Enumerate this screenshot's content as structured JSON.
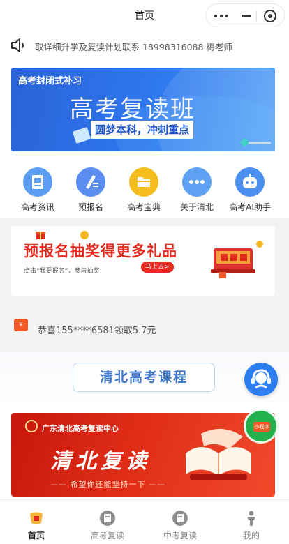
{
  "navbar": {
    "title": "首页"
  },
  "notice": {
    "text": "取详细升学及复读计划联系 18998316088 梅老师"
  },
  "banner": {
    "tag": "高考封闭式补习",
    "title": "高考复读班",
    "subtitle": "圆梦本科，冲刺重点"
  },
  "grid": {
    "items": [
      {
        "label": "高考资讯",
        "icon": "news-icon",
        "color": "#5b9df3"
      },
      {
        "label": "预报名",
        "icon": "pen-icon",
        "color": "#5b8ef0"
      },
      {
        "label": "高考宝典",
        "icon": "folder-icon",
        "color": "#f5bd1c"
      },
      {
        "label": "关于清北",
        "icon": "more-dots-icon",
        "color": "#5ea1f2"
      },
      {
        "label": "高考AI助手",
        "icon": "robot-icon",
        "color": "#4b8ff0"
      }
    ]
  },
  "prize": {
    "title": "预报名抽奖得更多礼品",
    "subtitle": "点击“我要报名”，参与抽奖",
    "button": "马上去>"
  },
  "congrats": {
    "text": "恭喜155****6581领取5.7元",
    "icon_text": "¥"
  },
  "course": {
    "title": "清北高考课程"
  },
  "qingbei": {
    "org": "广东清北高考复读中心",
    "title": "清北复读",
    "subtitle": "—— 希望你还能坚持一下 ——"
  },
  "float": {
    "mp_label": "小程序"
  },
  "tabbar": {
    "tabs": [
      {
        "label": "首页",
        "active": true
      },
      {
        "label": "高考复读",
        "active": false
      },
      {
        "label": "中考复读",
        "active": false
      },
      {
        "label": "我的",
        "active": false
      }
    ]
  }
}
